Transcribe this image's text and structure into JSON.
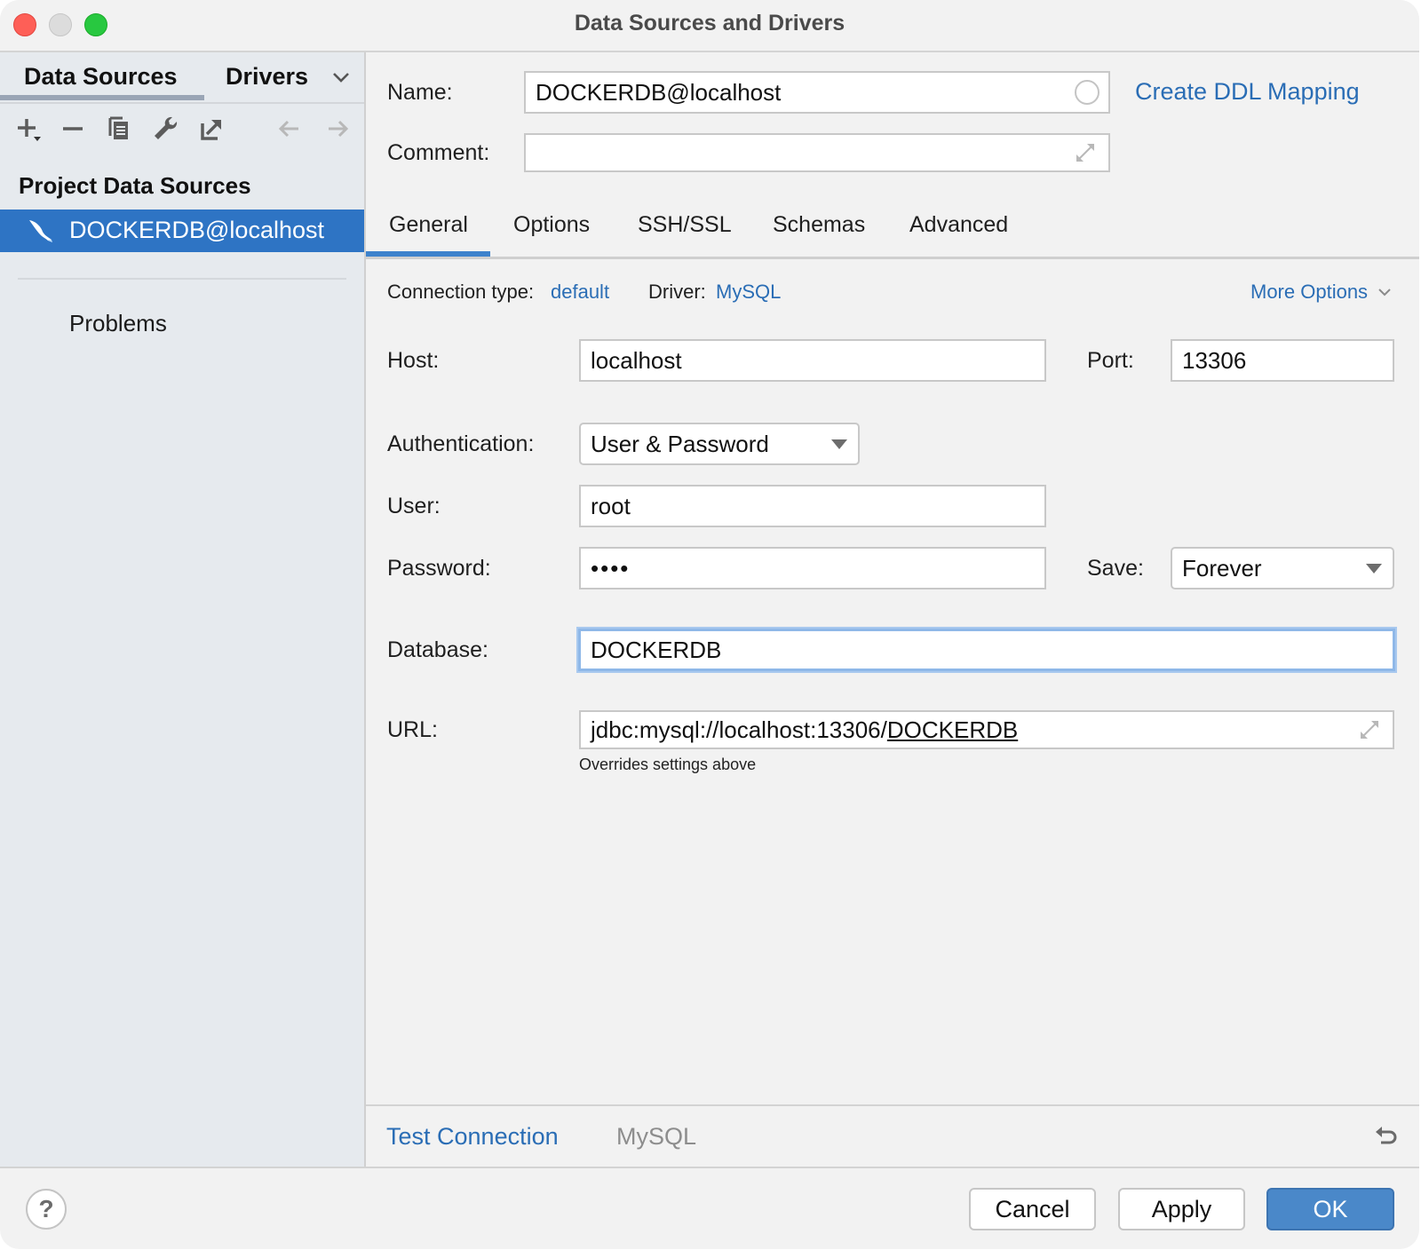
{
  "window": {
    "title": "Data Sources and Drivers"
  },
  "sidebar": {
    "tabs": [
      {
        "label": "Data Sources",
        "active": true
      },
      {
        "label": "Drivers",
        "active": false
      }
    ],
    "toolbar": {
      "icons": [
        "add-icon",
        "remove-icon",
        "duplicate-icon",
        "wrench-icon",
        "export-icon",
        "back-arrow-icon",
        "forward-arrow-icon"
      ]
    },
    "section_title": "Project Data Sources",
    "items": [
      {
        "label": "DOCKERDB@localhost",
        "icon": "mysql-dolphin-icon",
        "selected": true
      }
    ],
    "problems_label": "Problems"
  },
  "header": {
    "name_label": "Name:",
    "name_value": "DOCKERDB@localhost",
    "comment_label": "Comment:",
    "comment_value": "",
    "ddl_link": "Create DDL Mapping"
  },
  "tabs": [
    {
      "label": "General",
      "active": true
    },
    {
      "label": "Options",
      "active": false
    },
    {
      "label": "SSH/SSL",
      "active": false
    },
    {
      "label": "Schemas",
      "active": false
    },
    {
      "label": "Advanced",
      "active": false
    }
  ],
  "general": {
    "connection_type_label": "Connection type:",
    "connection_type_value": "default",
    "driver_label": "Driver:",
    "driver_value": "MySQL",
    "more_options": "More Options",
    "host_label": "Host:",
    "host_value": "localhost",
    "port_label": "Port:",
    "port_value": "13306",
    "auth_label": "Authentication:",
    "auth_value": "User & Password",
    "user_label": "User:",
    "user_value": "root",
    "password_label": "Password:",
    "password_value": "••••",
    "save_label": "Save:",
    "save_value": "Forever",
    "database_label": "Database:",
    "database_value": "DOCKERDB",
    "url_label": "URL:",
    "url_prefix": "jdbc:mysql://localhost:13306/",
    "url_db": "DOCKERDB",
    "url_hint": "Overrides settings above"
  },
  "footer": {
    "test_connection": "Test Connection",
    "driver_name": "MySQL"
  },
  "buttons": {
    "help": "?",
    "cancel": "Cancel",
    "apply": "Apply",
    "ok": "OK"
  },
  "colors": {
    "accent": "#2e74c4",
    "link": "#2a6db5",
    "primary_button": "#4a88c9",
    "focus_ring": "#8fb8e8"
  }
}
